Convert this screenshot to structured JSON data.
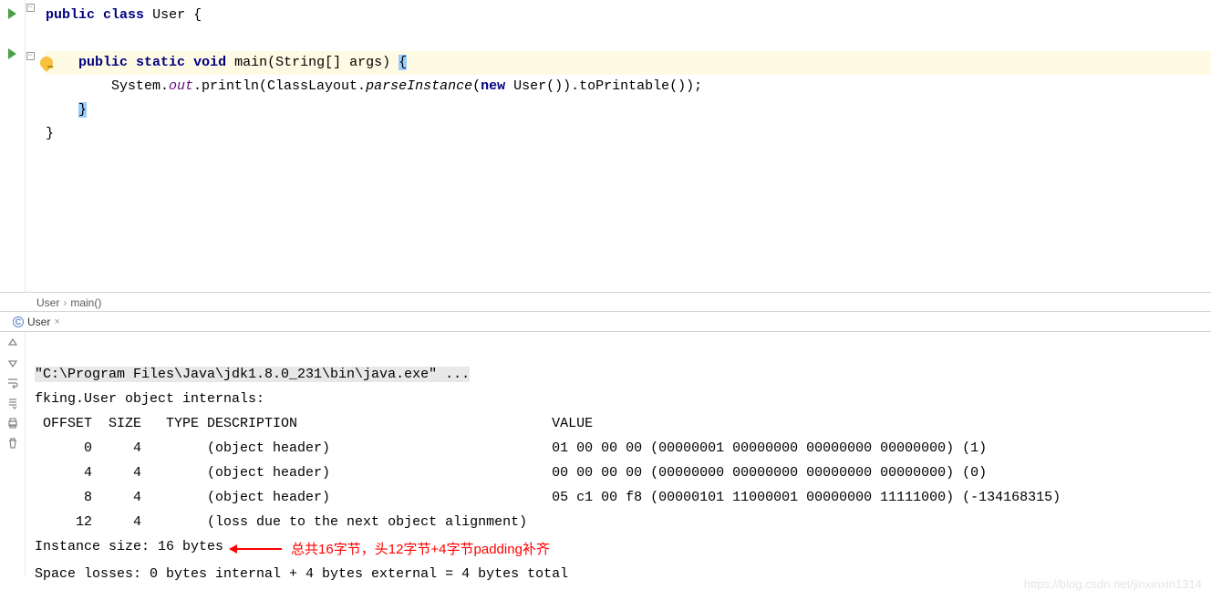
{
  "editor": {
    "line1": {
      "kw_public": "public",
      "kw_class": "class",
      "cls": "User",
      "brace": "{"
    },
    "line3": {
      "kw_public": "public",
      "kw_static": "static",
      "kw_void": "void",
      "fn": "main",
      "params": "(String[] args)",
      "brace": "{"
    },
    "line4": {
      "pre": "System.",
      "out": "out",
      "print": ".println(ClassLayout.",
      "parse": "parseInstance",
      "paren": "(",
      "kw_new": "new",
      "rest": " User()).toPrintable());"
    },
    "line5": {
      "brace": "}"
    },
    "line6": {
      "brace": "}"
    }
  },
  "breadcrumb": {
    "item1": "User",
    "item2": "main()"
  },
  "tab": {
    "label": "User"
  },
  "console": {
    "cmd": "\"C:\\Program Files\\Java\\jdk1.8.0_231\\bin\\java.exe\" ...",
    "line2": "fking.User object internals:",
    "header": " OFFSET  SIZE   TYPE DESCRIPTION                               VALUE",
    "row1": "      0     4        (object header)                           01 00 00 00 (00000001 00000000 00000000 00000000) (1)",
    "row2": "      4     4        (object header)                           00 00 00 00 (00000000 00000000 00000000 00000000) (0)",
    "row3": "      8     4        (object header)                           05 c1 00 f8 (00000101 11000001 00000000 11111000) (-134168315)",
    "row4": "     12     4        (loss due to the next object alignment)",
    "size": "Instance size: 16 bytes",
    "losses": "Space losses: 0 bytes internal + 4 bytes external = 4 bytes total",
    "annotation": "总共16字节，头12字节+4字节padding补齐"
  },
  "watermark": "https://blog.csdn.net/jinxinxin1314"
}
